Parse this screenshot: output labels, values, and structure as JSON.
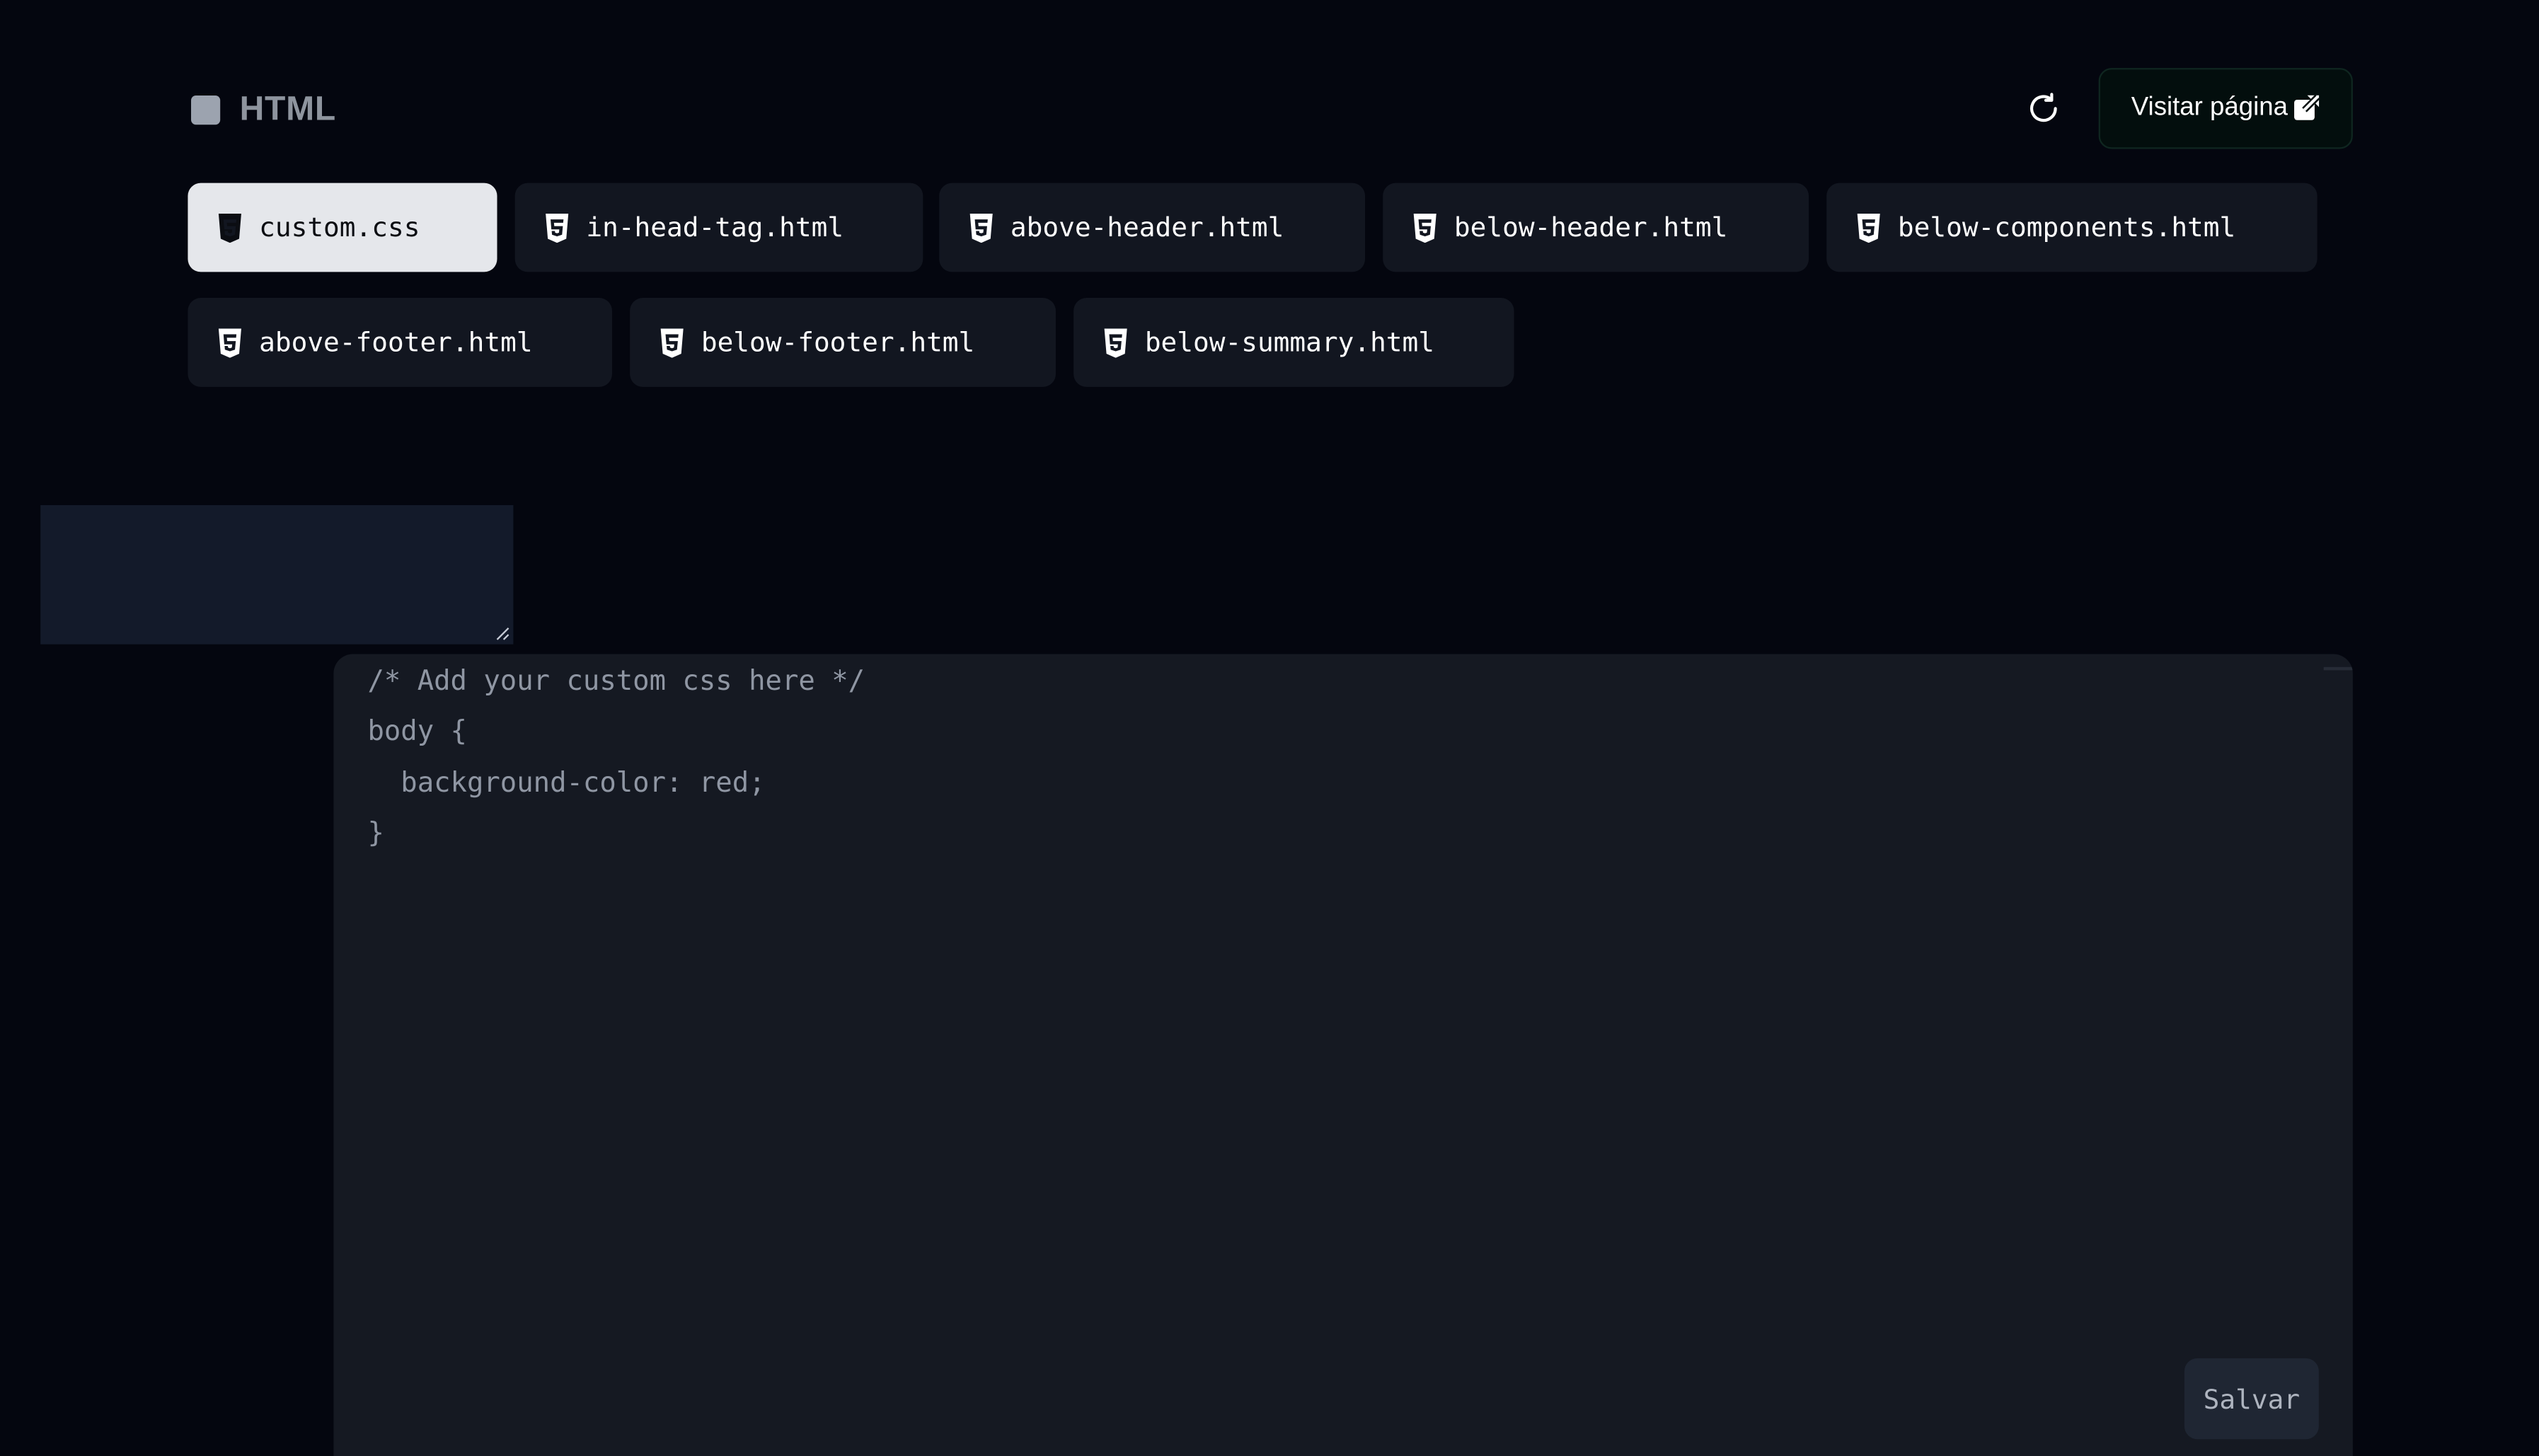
{
  "header": {
    "title": "HTML",
    "visit_label": "Visitar página"
  },
  "tabs": [
    {
      "label": "custom.css",
      "active": true
    },
    {
      "label": "in-head-tag.html",
      "active": false
    },
    {
      "label": "above-header.html",
      "active": false
    },
    {
      "label": "below-header.html",
      "active": false
    },
    {
      "label": "below-components.html",
      "active": false
    },
    {
      "label": "above-footer.html",
      "active": false
    },
    {
      "label": "below-footer.html",
      "active": false
    },
    {
      "label": "below-summary.html",
      "active": false
    }
  ],
  "editor": {
    "lines": [
      "/* Add your custom css here */",
      "body {",
      "  background-color: red;",
      "}"
    ],
    "save_label": "Salvar"
  },
  "icons": {
    "brand": "square-icon",
    "refresh": "refresh-icon",
    "external": "external-link-icon",
    "tab": "html5-icon"
  },
  "colors": {
    "background": "#04060f",
    "tab_bg": "#121620",
    "tab_active_bg": "#e5e7eb",
    "editor_bg": "#151922",
    "visit_btn_bg": "#030e0d"
  }
}
